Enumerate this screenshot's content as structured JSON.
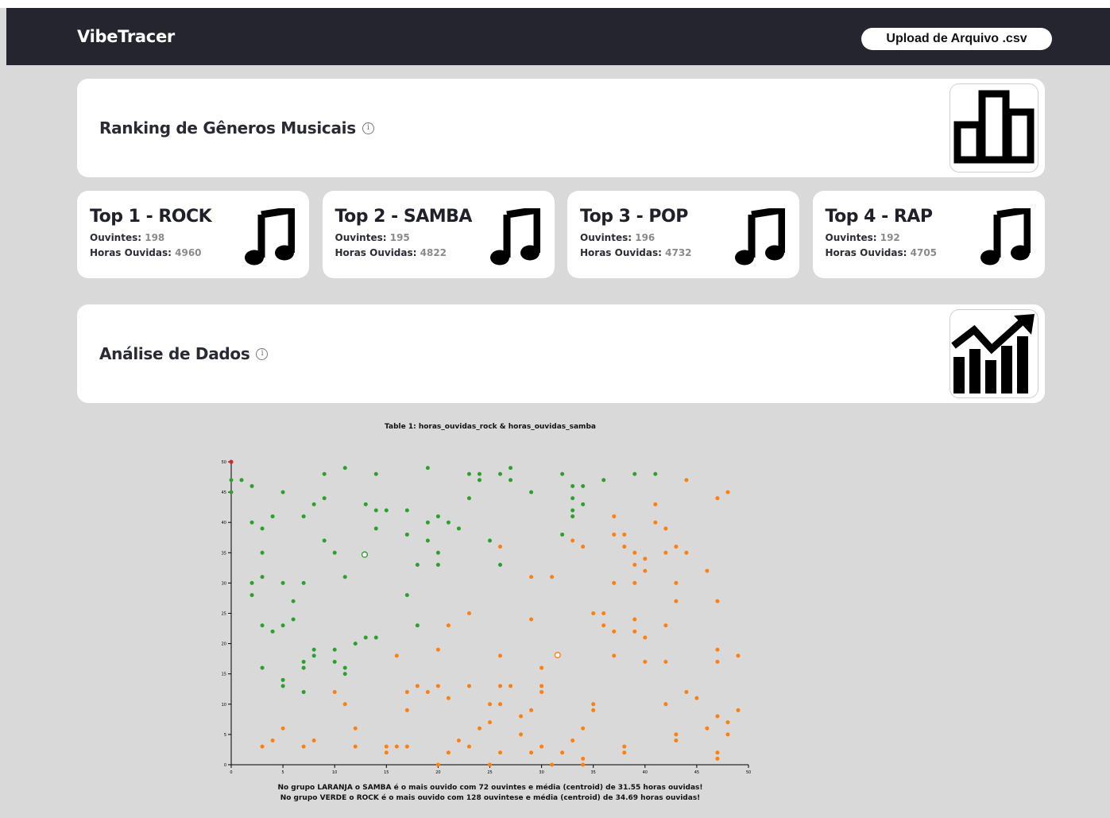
{
  "app": {
    "brand": "VibeTracer",
    "upload_label": "Upload de Arquivo .csv"
  },
  "ranking": {
    "title": "Ranking de Gêneros Musicais",
    "icon": "bar-chart-icon"
  },
  "top_cards": [
    {
      "title": "Top 1 - ROCK",
      "listeners_label": "Ouvintes:",
      "listeners": "198",
      "hours_label": "Horas Ouvidas:",
      "hours": "4960"
    },
    {
      "title": "Top 2 - SAMBA",
      "listeners_label": "Ouvintes:",
      "listeners": "195",
      "hours_label": "Horas Ouvidas:",
      "hours": "4822"
    },
    {
      "title": "Top 3 - POP",
      "listeners_label": "Ouvintes:",
      "listeners": "196",
      "hours_label": "Horas Ouvidas:",
      "hours": "4732"
    },
    {
      "title": "Top 4 - RAP",
      "listeners_label": "Ouvintes:",
      "listeners": "192",
      "hours_label": "Horas Ouvidas:",
      "hours": "4705"
    }
  ],
  "analysis": {
    "title": "Análise de Dados",
    "icon": "trending-chart-icon"
  },
  "captions": {
    "line1": "No grupo LARANJA o SAMBA é o mais ouvido com 72 ouvintes e média (centroid) de 31.55 horas ouvidas!",
    "line2": "No grupo VERDE o ROCK é o mais ouvido com 128 ouvintese e média (centroid) de 34.69 horas ouvidas!"
  },
  "chart_data": {
    "type": "scatter",
    "title": "Table 1: horas_ouvidas_rock & horas_ouvidas_samba",
    "xlim": [
      0,
      50
    ],
    "ylim": [
      0,
      50
    ],
    "xticks": [
      0,
      5,
      10,
      15,
      20,
      25,
      30,
      35,
      40,
      45,
      50
    ],
    "yticks": [
      0,
      5,
      10,
      15,
      20,
      25,
      30,
      35,
      40,
      45,
      50
    ],
    "colors": {
      "green": "#2ca02c",
      "orange": "#ff7f0e",
      "red": "#d62728"
    },
    "series": [
      {
        "color": "#2ca02c",
        "points": [
          [
            0,
            47
          ],
          [
            0,
            45
          ],
          [
            1,
            47
          ],
          [
            2,
            46
          ],
          [
            2,
            40
          ],
          [
            2,
            30
          ],
          [
            2,
            28
          ],
          [
            3,
            39
          ],
          [
            3,
            35
          ],
          [
            3,
            31
          ],
          [
            3,
            23
          ],
          [
            3,
            16
          ],
          [
            4,
            41
          ],
          [
            4,
            22
          ],
          [
            5,
            45
          ],
          [
            5,
            30
          ],
          [
            5,
            23
          ],
          [
            5,
            14
          ],
          [
            5,
            13
          ],
          [
            6,
            27
          ],
          [
            6,
            24
          ],
          [
            7,
            41
          ],
          [
            7,
            30
          ],
          [
            7,
            17
          ],
          [
            7,
            16
          ],
          [
            7,
            12
          ],
          [
            8,
            43
          ],
          [
            8,
            19
          ],
          [
            8,
            18
          ],
          [
            9,
            48
          ],
          [
            9,
            44
          ],
          [
            9,
            37
          ],
          [
            10,
            35
          ],
          [
            10,
            19
          ],
          [
            10,
            17
          ],
          [
            11,
            49
          ],
          [
            11,
            31
          ],
          [
            11,
            16
          ],
          [
            11,
            15
          ],
          [
            12,
            20
          ],
          [
            13,
            43
          ],
          [
            13,
            21
          ],
          [
            14,
            48
          ],
          [
            14,
            42
          ],
          [
            14,
            39
          ],
          [
            14,
            21
          ],
          [
            15,
            42
          ],
          [
            17,
            42
          ],
          [
            17,
            38
          ],
          [
            17,
            28
          ],
          [
            18,
            33
          ],
          [
            18,
            23
          ],
          [
            19,
            49
          ],
          [
            19,
            40
          ],
          [
            19,
            37
          ],
          [
            20,
            41
          ],
          [
            20,
            35
          ],
          [
            20,
            33
          ],
          [
            21,
            40
          ],
          [
            22,
            39
          ],
          [
            23,
            48
          ],
          [
            23,
            44
          ],
          [
            24,
            48
          ],
          [
            24,
            47
          ],
          [
            25,
            37
          ],
          [
            26,
            48
          ],
          [
            26,
            33
          ],
          [
            27,
            49
          ],
          [
            27,
            47
          ],
          [
            29,
            45
          ],
          [
            32,
            48
          ],
          [
            32,
            38
          ],
          [
            33,
            46
          ],
          [
            33,
            44
          ],
          [
            33,
            42
          ],
          [
            33,
            41
          ],
          [
            34,
            46
          ],
          [
            34,
            43
          ],
          [
            36,
            47
          ],
          [
            39,
            48
          ],
          [
            41,
            48
          ]
        ]
      },
      {
        "color": "#ff7f0e",
        "points": [
          [
            3,
            3
          ],
          [
            4,
            4
          ],
          [
            5,
            6
          ],
          [
            7,
            3
          ],
          [
            8,
            4
          ],
          [
            10,
            12
          ],
          [
            11,
            10
          ],
          [
            12,
            6
          ],
          [
            12,
            3
          ],
          [
            15,
            3
          ],
          [
            15,
            2
          ],
          [
            16,
            18
          ],
          [
            16,
            3
          ],
          [
            17,
            12
          ],
          [
            17,
            9
          ],
          [
            17,
            3
          ],
          [
            18,
            13
          ],
          [
            19,
            12
          ],
          [
            20,
            19
          ],
          [
            20,
            13
          ],
          [
            20,
            0
          ],
          [
            21,
            23
          ],
          [
            21,
            11
          ],
          [
            21,
            2
          ],
          [
            22,
            4
          ],
          [
            23,
            25
          ],
          [
            23,
            13
          ],
          [
            23,
            3
          ],
          [
            24,
            6
          ],
          [
            25,
            10
          ],
          [
            25,
            7
          ],
          [
            25,
            0
          ],
          [
            26,
            36
          ],
          [
            26,
            18
          ],
          [
            26,
            13
          ],
          [
            26,
            10
          ],
          [
            26,
            2
          ],
          [
            27,
            13
          ],
          [
            28,
            8
          ],
          [
            28,
            5
          ],
          [
            29,
            31
          ],
          [
            29,
            24
          ],
          [
            29,
            9
          ],
          [
            29,
            2
          ],
          [
            30,
            16
          ],
          [
            30,
            13
          ],
          [
            30,
            12
          ],
          [
            30,
            3
          ],
          [
            31,
            31
          ],
          [
            31,
            0
          ],
          [
            32,
            2
          ],
          [
            33,
            37
          ],
          [
            33,
            4
          ],
          [
            34,
            36
          ],
          [
            34,
            6
          ],
          [
            34,
            1
          ],
          [
            34,
            0
          ],
          [
            35,
            25
          ],
          [
            35,
            10
          ],
          [
            35,
            9
          ],
          [
            36,
            25
          ],
          [
            36,
            23
          ],
          [
            37,
            41
          ],
          [
            37,
            38
          ],
          [
            37,
            30
          ],
          [
            37,
            22
          ],
          [
            37,
            18
          ],
          [
            38,
            38
          ],
          [
            38,
            36
          ],
          [
            38,
            3
          ],
          [
            38,
            2
          ],
          [
            39,
            35
          ],
          [
            39,
            33
          ],
          [
            39,
            30
          ],
          [
            39,
            24
          ],
          [
            39,
            22
          ],
          [
            40,
            34
          ],
          [
            40,
            32
          ],
          [
            40,
            21
          ],
          [
            40,
            17
          ],
          [
            41,
            43
          ],
          [
            41,
            40
          ],
          [
            42,
            39
          ],
          [
            42,
            35
          ],
          [
            42,
            23
          ],
          [
            42,
            17
          ],
          [
            42,
            10
          ],
          [
            43,
            36
          ],
          [
            43,
            30
          ],
          [
            43,
            27
          ],
          [
            43,
            5
          ],
          [
            43,
            4
          ],
          [
            44,
            47
          ],
          [
            44,
            35
          ],
          [
            44,
            12
          ],
          [
            45,
            11
          ],
          [
            46,
            32
          ],
          [
            46,
            6
          ],
          [
            47,
            44
          ],
          [
            47,
            27
          ],
          [
            47,
            19
          ],
          [
            47,
            17
          ],
          [
            47,
            8
          ],
          [
            47,
            2
          ],
          [
            47,
            1
          ],
          [
            48,
            45
          ],
          [
            48,
            7
          ],
          [
            48,
            5
          ],
          [
            49,
            18
          ],
          [
            49,
            9
          ]
        ]
      }
    ],
    "centroids": [
      {
        "color": "#2ca02c",
        "x": 12.9,
        "y": 34.69
      },
      {
        "color": "#ff7f0e",
        "x": 31.55,
        "y": 18.1
      }
    ],
    "marker": {
      "color": "#d62728",
      "x": 0,
      "y": 50
    }
  }
}
